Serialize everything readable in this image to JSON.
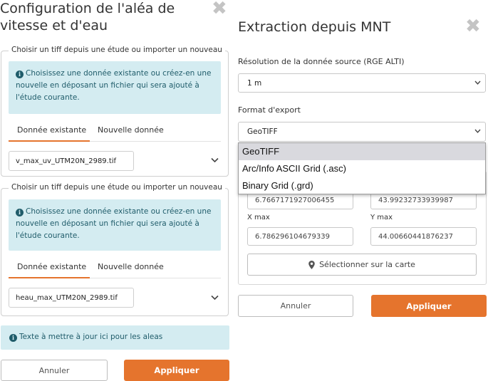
{
  "left_panel": {
    "title": "Configuration de l'aléa de vitesse et d'eau",
    "groups": [
      {
        "legend": "Choisir un tiff depuis une étude ou importer un nouveau",
        "info": "Choisissez une donnée existante ou créez-en une nouvelle en déposant un fichier qui sera ajouté à l'étude courante.",
        "tabs": [
          "Donnée existante",
          "Nouvelle donnée"
        ],
        "active_tab": 0,
        "file": "v_max_uv_UTM20N_2989.tif"
      },
      {
        "legend": "Choisir un tiff depuis une étude ou importer un nouveau",
        "info": "Choisissez une donnée existante ou créez-en une nouvelle en déposant un fichier qui sera ajouté à l'étude courante.",
        "tabs": [
          "Donnée existante",
          "Nouvelle donnée"
        ],
        "active_tab": 0,
        "file": "heau_max_UTM20N_2989.tif"
      }
    ],
    "note": "Texte à mettre à jour ici pour les aleas",
    "cancel_label": "Annuler",
    "apply_label": "Appliquer"
  },
  "right_panel": {
    "title": "Extraction depuis MNT",
    "resolution_label": "Résolution de la donnée source (RGE ALTI)",
    "resolution_value": "1 m",
    "format_label": "Format d'export",
    "format_value": "GeoTIFF",
    "format_options": [
      "GeoTIFF",
      "Arc/Info ASCII Grid (.asc)",
      "Binary Grid (.grd)"
    ],
    "xmin_value": "6.7667171927006455",
    "ymin_value": "43.99232733939987",
    "xmax_label": "X max",
    "xmax_value": "6.786296104679339",
    "ymax_label": "Y max",
    "ymax_value": "44.00660441876237",
    "map_button_label": "Sélectionner sur la carte",
    "cancel_label": "Annuler",
    "apply_label": "Appliquer"
  },
  "colors": {
    "accent": "#e5742d",
    "info_bg": "#d4ecf1",
    "info_text": "#1f5c6a",
    "close_icon": "#c4c4c4"
  },
  "icons": {
    "close": "close-icon",
    "info": "info-icon",
    "chevron": "chevron-down-icon",
    "map_marker": "map-marker-icon"
  }
}
